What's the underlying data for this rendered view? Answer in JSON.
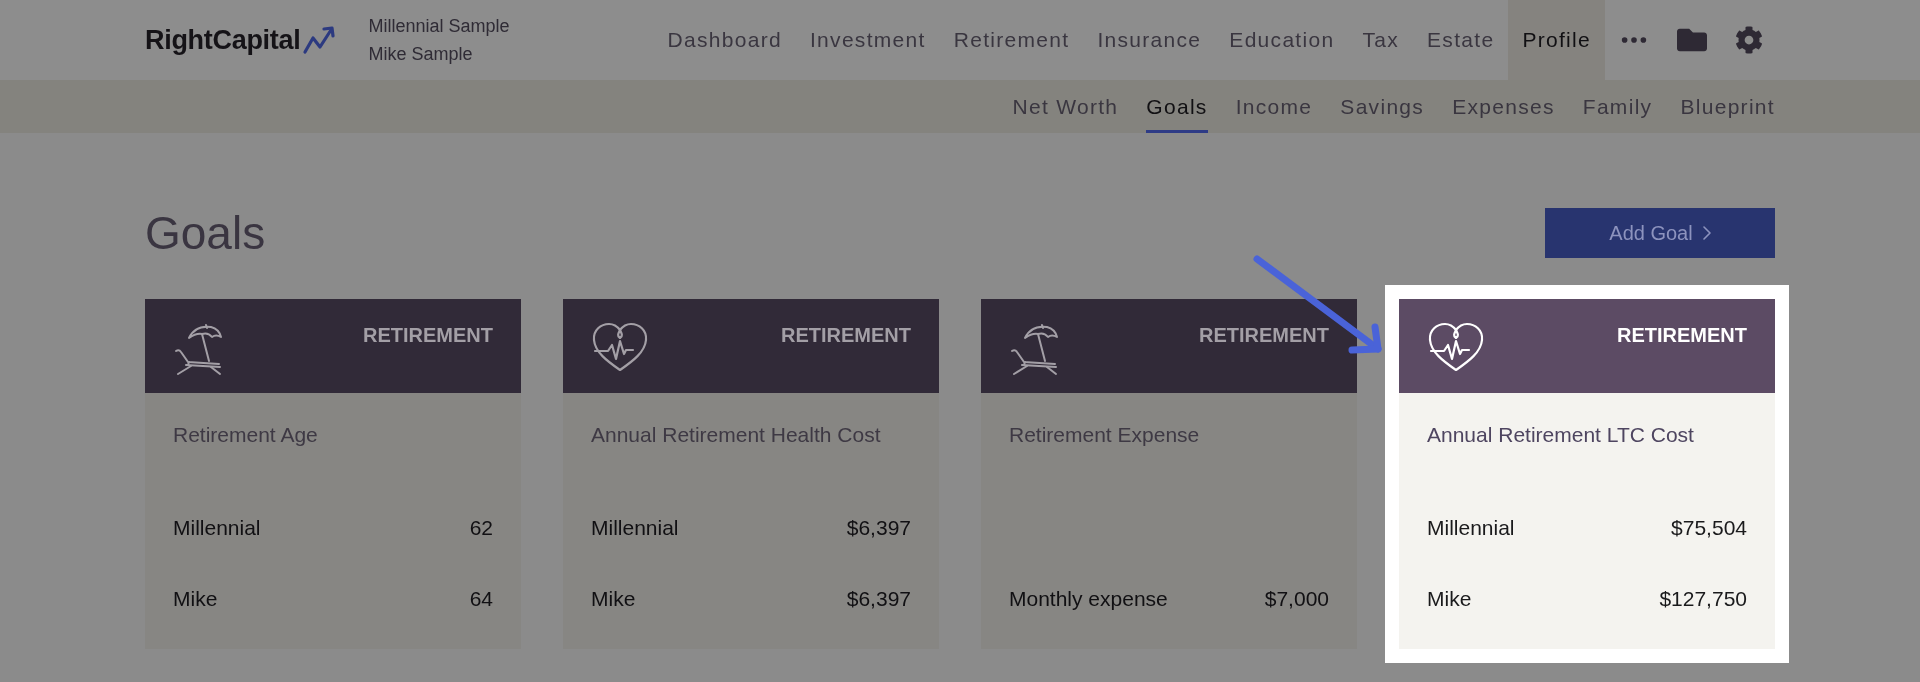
{
  "header": {
    "logo": "RightCapital",
    "clients": [
      "Millennial Sample",
      "Mike Sample"
    ],
    "nav": [
      {
        "label": "Dashboard",
        "selected": false
      },
      {
        "label": "Investment",
        "selected": false
      },
      {
        "label": "Retirement",
        "selected": false
      },
      {
        "label": "Insurance",
        "selected": false
      },
      {
        "label": "Education",
        "selected": false
      },
      {
        "label": "Tax",
        "selected": false
      },
      {
        "label": "Estate",
        "selected": false
      },
      {
        "label": "Profile",
        "selected": true
      }
    ]
  },
  "subnav": [
    {
      "label": "Net Worth",
      "selected": false
    },
    {
      "label": "Goals",
      "selected": true
    },
    {
      "label": "Income",
      "selected": false
    },
    {
      "label": "Savings",
      "selected": false
    },
    {
      "label": "Expenses",
      "selected": false
    },
    {
      "label": "Family",
      "selected": false
    },
    {
      "label": "Blueprint",
      "selected": false
    }
  ],
  "page": {
    "title": "Goals",
    "add_button": "Add Goal"
  },
  "goals": [
    {
      "kind": "leisure",
      "category": "RETIREMENT",
      "title": "Retirement Age",
      "highlighted": false,
      "rows": [
        {
          "label": "Millennial",
          "value": "62"
        },
        {
          "label": "Mike",
          "value": "64"
        }
      ]
    },
    {
      "kind": "health",
      "category": "RETIREMENT",
      "title": "Annual Retirement Health Cost",
      "highlighted": false,
      "rows": [
        {
          "label": "Millennial",
          "value": "$6,397"
        },
        {
          "label": "Mike",
          "value": "$6,397"
        }
      ]
    },
    {
      "kind": "leisure",
      "category": "RETIREMENT",
      "title": "Retirement Expense",
      "highlighted": false,
      "rows": [
        {
          "label": "Monthly expense",
          "value": "$7,000"
        }
      ]
    },
    {
      "kind": "health",
      "category": "RETIREMENT",
      "title": "Annual Retirement LTC Cost",
      "highlighted": true,
      "rows": [
        {
          "label": "Millennial",
          "value": "$75,504"
        },
        {
          "label": "Mike",
          "value": "$127,750"
        }
      ]
    }
  ]
}
